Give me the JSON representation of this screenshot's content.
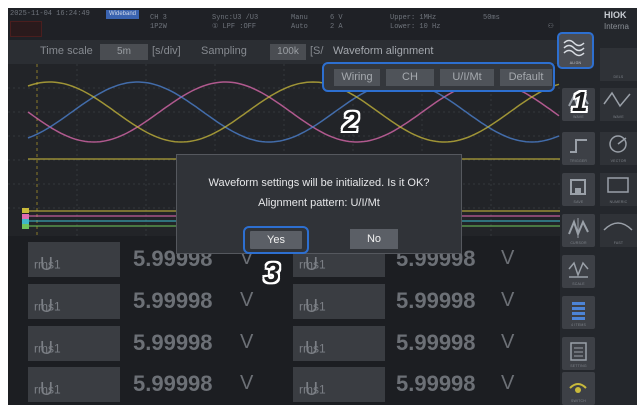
{
  "status_bar": {
    "datetime": "2025-11-04 16:24:49",
    "mode_tag": "Wideband",
    "ch": "CH 3",
    "wiring": "1P2W",
    "sync": "Sync:U3  /U3",
    "lpf": "① LPF :OFF",
    "range_mode_v": "Manu",
    "range_mode_a": "Auto",
    "range_v": "6 V",
    "range_a": "2 A",
    "upper": "Upper: 1MHz",
    "lower": "Lower: 10 Hz",
    "interval": "50ms",
    "brand": "HIOK",
    "brand_sub": "Interna"
  },
  "toolbar": {
    "time_scale_label": "Time scale",
    "time_scale_value": "5m",
    "time_scale_unit": "[s/div]",
    "sampling_label": "Sampling",
    "sampling_value": "100k",
    "sampling_unit": "[S/",
    "title": "Waveform alignment"
  },
  "alignment_buttons": [
    "Wiring",
    "CH",
    "U/I/Mt",
    "Default"
  ],
  "sidebar": {
    "items": [
      {
        "label": "ALIGN",
        "icon": "wave-align-icon"
      },
      {
        "label": "WAVE",
        "icon": "wave-icon"
      },
      {
        "label": "TRIGGER",
        "icon": "trigger-icon"
      },
      {
        "label": "SAVE",
        "icon": "save-icon"
      },
      {
        "label": "CURSOR",
        "icon": "cursor-icon"
      },
      {
        "label": "SCALE",
        "icon": "scale-icon"
      },
      {
        "label": "4 ITEMS",
        "icon": "four-items-icon"
      },
      {
        "label": "SETTING",
        "icon": "setting-icon"
      },
      {
        "label": "SWITCH",
        "icon": "switch-icon"
      }
    ],
    "side_items": [
      "DELS",
      "WAVE",
      "VECTOR",
      "NUMERIC",
      "FAST",
      "DISPLAY"
    ]
  },
  "measurements": [
    {
      "label": "U",
      "sub": "rms1",
      "value": "5.99998",
      "unit": "V"
    },
    {
      "label": "U",
      "sub": "rms1",
      "value": "5.99998",
      "unit": "V"
    },
    {
      "label": "U",
      "sub": "rms1",
      "value": "5.99998",
      "unit": "V"
    },
    {
      "label": "U",
      "sub": "rms1",
      "value": "5.99998",
      "unit": "V"
    },
    {
      "label": "U",
      "sub": "rms1",
      "value": "5.99998",
      "unit": "V"
    },
    {
      "label": "U",
      "sub": "rms1",
      "value": "5.99998",
      "unit": "V"
    },
    {
      "label": "U",
      "sub": "rms1",
      "value": "5.99998",
      "unit": "V"
    },
    {
      "label": "U",
      "sub": "rms1",
      "value": "5.99998",
      "unit": "V"
    }
  ],
  "dialog": {
    "message": "Waveform settings will be initialized. Is it OK?",
    "pattern": "Alignment pattern: U/I/Mt",
    "yes_label": "Yes",
    "no_label": "No"
  },
  "steps": [
    "1",
    "2",
    "3"
  ],
  "colors": {
    "highlight": "#2d6fd0",
    "wave_magenta": "#e06bb0",
    "wave_blue": "#4d84d6",
    "wave_yellow": "#c9ba3b",
    "wave_cyan": "#3fb7c7",
    "wave_green": "#6fc25a"
  }
}
